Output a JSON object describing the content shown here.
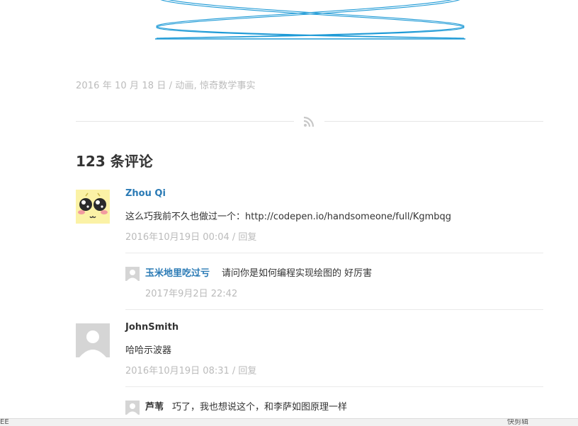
{
  "post": {
    "date": "2016 年 10 月 18 日",
    "slash": " / ",
    "categories": "动画, 惊奇数学事实"
  },
  "comments": {
    "title": "123 条评论",
    "items": [
      {
        "author": "Zhou Qi",
        "text": "这么巧我前不久也做过一个：http://codepen.io/handsomeone/full/Kgmbqg",
        "date": "2016年10月19日 00:04",
        "reply": "回复",
        "replies": [
          {
            "author": "玉米地里吃过亏",
            "text": "请问你是如何编程实现绘图的 好厉害",
            "date": "2017年9月2日 22:42"
          }
        ]
      },
      {
        "author": "JohnSmith",
        "text": "哈哈示波器",
        "date": "2016年10月19日 08:31",
        "reply": "回复",
        "replies": [
          {
            "author": "芦苇",
            "text": "巧了，我也想说这个，和李萨如图原理一样"
          }
        ]
      }
    ]
  },
  "statusbar": {
    "left": "ÉÈ",
    "right": "快剪辑"
  },
  "colors": {
    "accent": "#2a7ab5",
    "art": "#1e9ad6",
    "meta": "#bbbbbb"
  }
}
